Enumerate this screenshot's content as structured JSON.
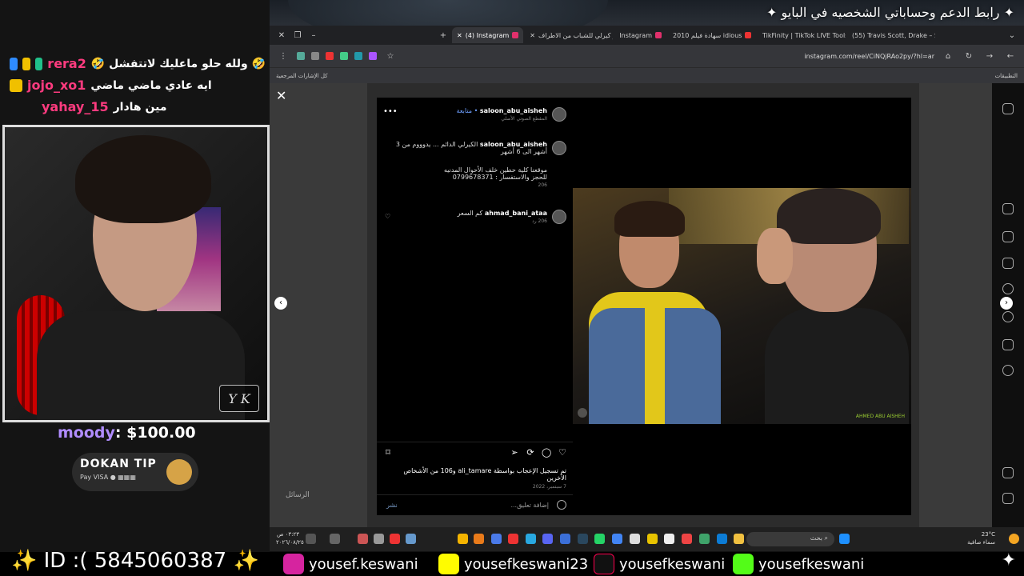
{
  "overlay": {
    "title": "رابط الدعم وحساباتي الشخصيه في البايو",
    "stream_id": "✨ ID :( 5845060387 ✨",
    "sparkle": "✦"
  },
  "chat": [
    {
      "user": "rera2",
      "message": "🤣 ولله حلو ماعليك لاتتفشل 🤣",
      "color": "pink"
    },
    {
      "user": "jojo_xo1",
      "message": "ايه عادي ماضي ماضي",
      "color": "pink"
    },
    {
      "user": "yahay_15",
      "message": "مين هادار",
      "color": "pink"
    }
  ],
  "camera": {
    "tag": "Y K"
  },
  "donation": {
    "user": "moody",
    "amount": "$100.00"
  },
  "dokan": {
    "title": "DOKAN TIP",
    "payments": "Pay  VISA  ●  ▦▦▦"
  },
  "browser": {
    "tabs": [
      {
        "label": "(4) Instagram",
        "active": true,
        "color": "#e1306c"
      },
      {
        "label": "شعر كيرلي للشباب من الاطراف",
        "active": false,
        "color": "#ccc"
      },
      {
        "label": "Instagram",
        "active": false,
        "color": "#e1306c"
      },
      {
        "label": "سهادة فيلم 2010 idious",
        "active": false,
        "color": "#e33"
      },
      {
        "label": "TikFinity | TikTok LIVE Tools",
        "active": false,
        "color": "#e33"
      },
      {
        "label": "(55) Travis Scott, Drake – Si",
        "active": false,
        "color": "#f00"
      }
    ],
    "url": "instagram.com/reel/CiNQjRAo2py/?hl=ar",
    "bookmarks_left": "كل الإشارات المرجعية",
    "bookmarks_right": "التطبيقات"
  },
  "post": {
    "comments": [
      {
        "user": "saloon_abu_aisheh",
        "text": "• متابعة",
        "meta": "المقطع الصوتي الأصلي"
      },
      {
        "user": "saloon_abu_aisheh",
        "text": "الكيرلي الدائم ... يدوووم من 3 أشهر الى 6 أشهر",
        "extra1": "موقعنا كلية حطين خلف الأحوال المدنيه",
        "extra2": "للحجز والاستفسار : 0799678371",
        "meta": "206"
      },
      {
        "user": "ahmad_bani_ataa",
        "text": "كم السعر",
        "meta": "206  رد"
      }
    ],
    "likes_text": "تم تسجيل الإعجاب بواسطة ali_tamare و106 من الأشخاص الآخرين",
    "date": "7 سبتمبر، 2022",
    "add_comment_placeholder": "إضافة تعليق...",
    "post_button": "نشر",
    "watermark": "AHMED ABU AISHEH",
    "messages_label": "الرسائل"
  },
  "taskbar": {
    "time": "٠٣:٢٣ ص",
    "date": "٢٠٢٦/٠٨/٢٥",
    "search": "بحث",
    "weather_temp": "23°C",
    "weather_desc": "سماء صافية"
  },
  "socials": [
    {
      "name": "instagram",
      "handle": "yousef.keswani",
      "color": "#d6249f"
    },
    {
      "name": "snapchat",
      "handle": "yousefkeswani23",
      "color": "#fffc00"
    },
    {
      "name": "tiktok",
      "handle": "yousefkeswani",
      "color": "#000"
    },
    {
      "name": "kick",
      "handle": "yousefkeswani",
      "color": "#53fc18"
    }
  ],
  "colors": {
    "accent_pink": "#ff3b7f",
    "accent_yellow": "#f0d000",
    "donation_name": "#b08cff"
  }
}
